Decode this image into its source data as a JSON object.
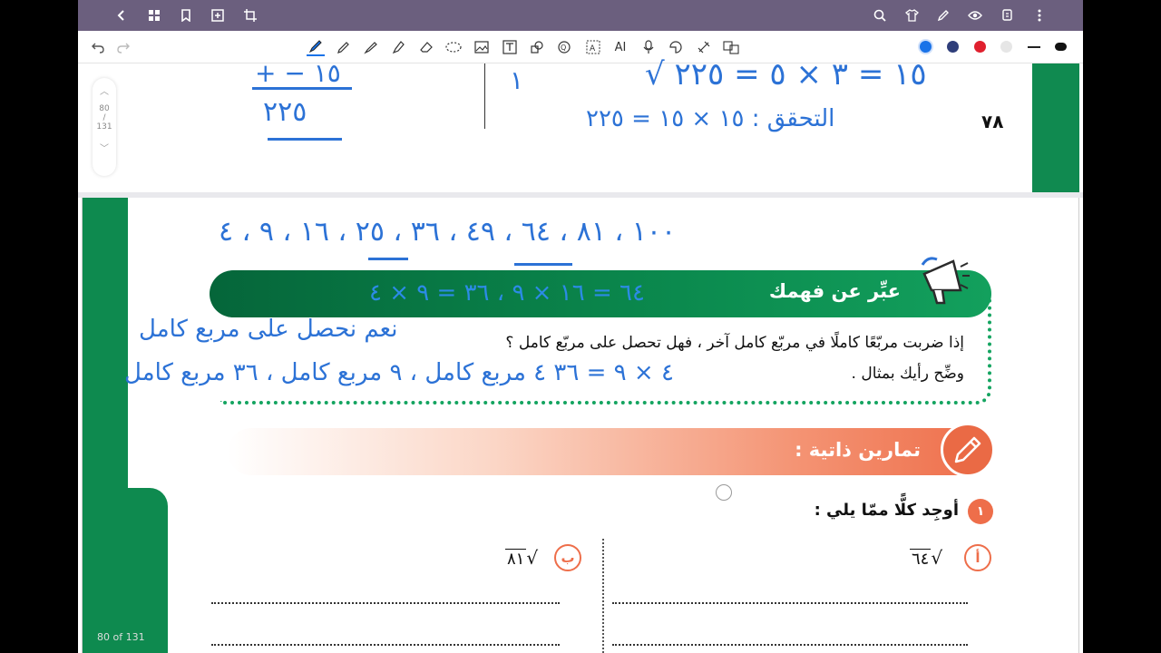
{
  "toolbar": {
    "icons": [
      "back-icon",
      "grid-icon",
      "bookmark-icon",
      "add-page-icon",
      "crop-icon"
    ],
    "right_icons": [
      "search-icon",
      "shirt-icon",
      "pen-icon",
      "eye-icon",
      "copy-icon",
      "more-icon"
    ],
    "tools": [
      "undo-icon",
      "redo-icon",
      "fountain-pen-icon",
      "pencil-icon",
      "marker-icon",
      "highlighter-icon",
      "eraser-icon",
      "lasso-icon",
      "image-icon",
      "textbox-icon",
      "shapes-icon",
      "ocr-icon",
      "translate-icon",
      "ai-icon",
      "mic-icon",
      "sticker-icon",
      "link-icon",
      "translate-2-icon"
    ],
    "ai_label": "AI",
    "colors": [
      "#1a73e8",
      "#2f3e7a",
      "#e0202e",
      "#cfcfcf",
      "#111111",
      "#111111"
    ]
  },
  "pager": {
    "current": "80",
    "sep": "/",
    "total": "131",
    "footer": "80 of 131"
  },
  "prev_page": {
    "problem_number": "٧٨",
    "hand_top_right": "١٥ = ٣ × ٥ = ٢٢٥ √",
    "hand_check": "التحقق : ١٥ × ١٥ = ٢٢٥",
    "hand_left_top": "١٥ −  +",
    "hand_left_result": "٢٢٥",
    "hand_mid": "١"
  },
  "page": {
    "hand_sequence": "١٠٠ ، ٨١ ، ٦٤ ، ٤٩ ، ٣٦ ، ٢٥ ، ١٦ ، ٩ ، ٤",
    "banner_title": "عبِّر عن فهمك",
    "banner_hand": "٦٤ = ١٦ × ٩ ، ٣٦ = ٩ × ٤",
    "question_line1": "إذا ضربت مربّعًا كاملًا في مربّع كامل آخر ، فهل تحصل على مربّع كامل ؟",
    "question_line2": "وضِّح رأيك بمثال .",
    "hand_answer1": "نعم نحصل على مربع كامل",
    "hand_answer2": "٤ × ٩ = ٣٦  ٤ مربع كامل ، ٩ مربع كامل ، ٣٦ مربع كامل",
    "exercises_title": "تمارين ذاتية :",
    "q1_number": "١",
    "q1_text": "أوجِد كلًّا ممّا يلي :",
    "part_a_label": "أ",
    "part_a_expr": "٦٤",
    "part_b_label": "ب",
    "part_b_expr": "٨١"
  }
}
